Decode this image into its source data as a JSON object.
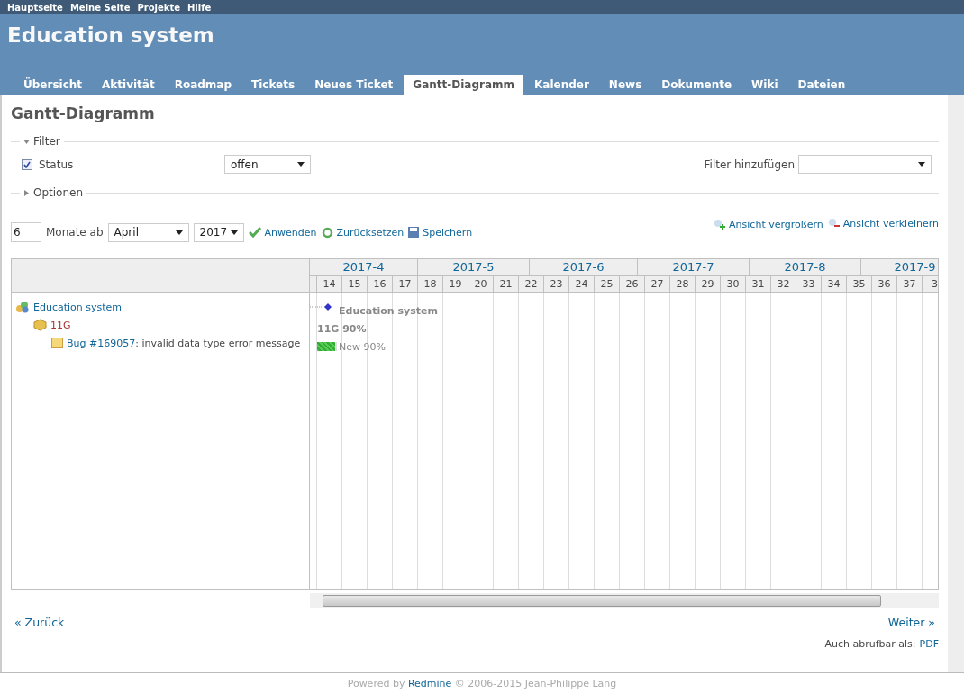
{
  "top_menu": [
    "Hauptseite",
    "Meine Seite",
    "Projekte",
    "Hilfe"
  ],
  "project_title": "Education system",
  "tabs": [
    {
      "label": "Übersicht",
      "selected": false
    },
    {
      "label": "Aktivität",
      "selected": false
    },
    {
      "label": "Roadmap",
      "selected": false
    },
    {
      "label": "Tickets",
      "selected": false
    },
    {
      "label": "Neues Ticket",
      "selected": false
    },
    {
      "label": "Gantt-Diagramm",
      "selected": true
    },
    {
      "label": "Kalender",
      "selected": false
    },
    {
      "label": "News",
      "selected": false
    },
    {
      "label": "Dokumente",
      "selected": false
    },
    {
      "label": "Wiki",
      "selected": false
    },
    {
      "label": "Dateien",
      "selected": false
    }
  ],
  "page_title": "Gantt-Diagramm",
  "filter": {
    "legend": "Filter",
    "expanded": true,
    "status_label": "Status",
    "status_checked": true,
    "status_value": "offen",
    "add_filter_label": "Filter hinzufügen"
  },
  "options": {
    "legend": "Optionen",
    "expanded": false
  },
  "controls": {
    "months": "6",
    "months_label": "Monate ab",
    "month": "April",
    "year": "2017",
    "apply": "Anwenden",
    "reset": "Zurücksetzen",
    "save": "Speichern",
    "zoom_in": "Ansicht vergrößern",
    "zoom_out": "Ansicht verkleinern"
  },
  "gantt": {
    "months": [
      "2017-4",
      "2017-5",
      "2017-6",
      "2017-7",
      "2017-8",
      "2017-9"
    ],
    "weeks": [
      "14",
      "15",
      "16",
      "17",
      "18",
      "19",
      "20",
      "21",
      "22",
      "23",
      "24",
      "25",
      "26",
      "27",
      "28",
      "29",
      "30",
      "31",
      "32",
      "33",
      "34",
      "35",
      "36",
      "37",
      "3"
    ],
    "rows": [
      {
        "kind": "project",
        "name": "Education system",
        "bar_label": "Education system"
      },
      {
        "kind": "version",
        "name": "11G",
        "bar_label": "11G 90%"
      },
      {
        "kind": "issue",
        "tracker_id": "Bug #169057",
        "subject": ": invalid data type error message",
        "bar_label": "New 90%",
        "level": 0.9
      }
    ]
  },
  "prev": "« Zurück",
  "next": "Weiter »",
  "export_label": "Auch abrufbar als:",
  "export_link": "PDF",
  "footer": {
    "prefix": "Powered by",
    "link": "Redmine",
    "suffix": "© 2006-2015 Jean-Philippe Lang"
  }
}
